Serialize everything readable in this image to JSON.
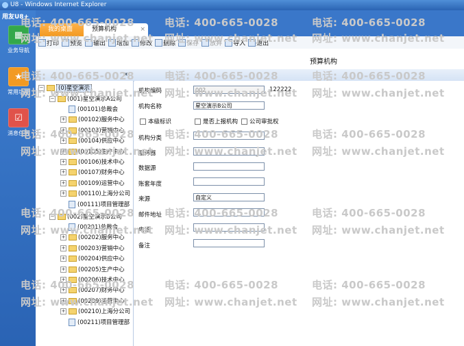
{
  "window": {
    "title": "U8 - Windows Internet Explorer"
  },
  "brand": "用友U8+",
  "nav": [
    {
      "label": "业务导航",
      "icon": "grid-icon"
    },
    {
      "label": "常用功能",
      "icon": "star-icon"
    },
    {
      "label": "消息任务",
      "icon": "checklist-icon"
    }
  ],
  "tabs": {
    "home": "我的桌面",
    "budget": "预算机构",
    "close": "×"
  },
  "toolbar": {
    "print": "打印",
    "preview": "预览",
    "export": "输出",
    "add": "增加",
    "modify": "修改",
    "delete": "删除",
    "save": "保存",
    "abandon": "放弃",
    "import": "导入",
    "exit": "退出"
  },
  "form": {
    "title": "预算机构",
    "collapse": "«",
    "code_label": "机构编码",
    "code_value": "002",
    "code_extra": "122222",
    "name_label": "机构名称",
    "name_value": "星空演示B公司",
    "chk_level": "本级标识",
    "chk_report": "是否上报机构",
    "chk_approve": "公司审批权",
    "category_label": "机构分类",
    "server_label": "服务器",
    "datasource_label": "数据源",
    "year_label": "账套年度",
    "source_label": "来源",
    "source_value": "自定义",
    "email_label": "邮件地址",
    "phone_label": "电话",
    "remark_label": "备注"
  },
  "tree": {
    "root": "(0)星空演示",
    "companyA": "(001)星空演示A公司",
    "a": [
      "(00101)总裁会",
      "(00102)服务中心",
      "(00103)营销中心",
      "(00104)供应中心",
      "(00105)生产中心",
      "(00106)技术中心",
      "(00107)财务中心",
      "(00109)运营中心",
      "(00110)上海分公司",
      "(00111)项目管理部"
    ],
    "companyB": "(002)星空演示B公司",
    "b": [
      "(00201)总裁会",
      "(00202)服务中心",
      "(00203)营销中心",
      "(00204)供应中心",
      "(00205)生产中心",
      "(00206)技术中心",
      "(00207)财务中心",
      "(00209)运营中心",
      "(00210)上海分公司",
      "(00211)项目管理部"
    ]
  },
  "watermark": {
    "phone": "电话: 400-665-0028",
    "site": "网址: www.chanjet.net"
  }
}
